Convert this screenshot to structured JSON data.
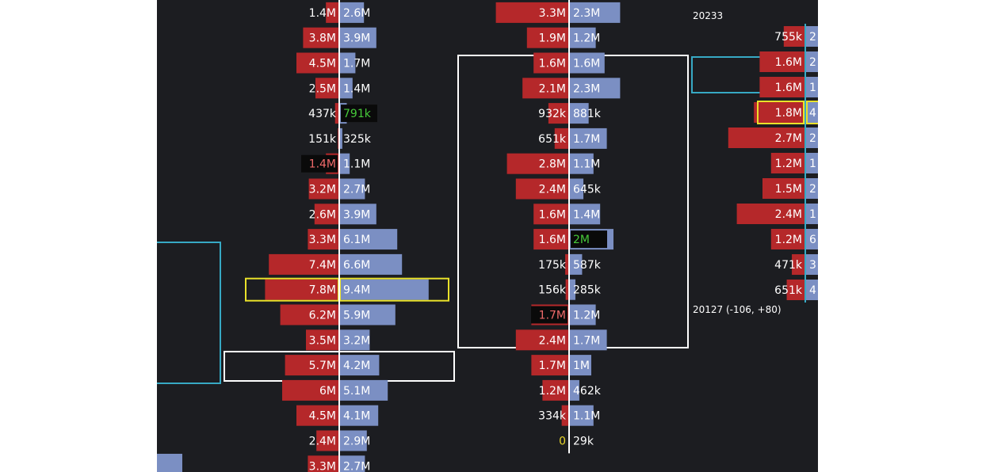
{
  "chart_data": {
    "type": "bar",
    "columns": [
      {
        "name_hint": "",
        "rows": [
          {
            "sell": "1.4M",
            "buy": "2.6M",
            "sell_value": 1.4,
            "buy_value": 2.6
          },
          {
            "sell": "3.8M",
            "buy": "3.9M",
            "sell_value": 3.8,
            "buy_value": 3.9
          },
          {
            "sell": "4.5M",
            "buy": "1.7M",
            "sell_value": 4.5,
            "buy_value": 1.7
          },
          {
            "sell": "2.5M",
            "buy": "1.4M",
            "sell_value": 2.5,
            "buy_value": 1.4
          },
          {
            "sell": "437k",
            "buy": "791k",
            "sell_value": 0.437,
            "buy_value": 0.791,
            "buy_highlight": "green"
          },
          {
            "sell": "151k",
            "buy": "325k",
            "sell_value": 0.151,
            "buy_value": 0.325
          },
          {
            "sell": "1.4M",
            "buy": "1.1M",
            "sell_value": 1.4,
            "buy_value": 1.1,
            "sell_highlight": "red"
          },
          {
            "sell": "3.2M",
            "buy": "2.7M",
            "sell_value": 3.2,
            "buy_value": 2.7
          },
          {
            "sell": "2.6M",
            "buy": "3.9M",
            "sell_value": 2.6,
            "buy_value": 3.9
          },
          {
            "sell": "3.3M",
            "buy": "6.1M",
            "sell_value": 3.3,
            "buy_value": 6.1
          },
          {
            "sell": "7.4M",
            "buy": "6.6M",
            "sell_value": 7.4,
            "buy_value": 6.6
          },
          {
            "sell": "7.8M",
            "buy": "9.4M",
            "sell_value": 7.8,
            "buy_value": 9.4,
            "poc": true
          },
          {
            "sell": "6.2M",
            "buy": "5.9M",
            "sell_value": 6.2,
            "buy_value": 5.9
          },
          {
            "sell": "3.5M",
            "buy": "3.2M",
            "sell_value": 3.5,
            "buy_value": 3.2
          },
          {
            "sell": "5.7M",
            "buy": "4.2M",
            "sell_value": 5.7,
            "buy_value": 4.2
          },
          {
            "sell": "6M",
            "buy": "5.1M",
            "sell_value": 6.0,
            "buy_value": 5.1
          },
          {
            "sell": "4.5M",
            "buy": "4.1M",
            "sell_value": 4.5,
            "buy_value": 4.1
          },
          {
            "sell": "2.4M",
            "buy": "2.9M",
            "sell_value": 2.4,
            "buy_value": 2.9
          },
          {
            "sell": "3.3M",
            "buy": "2.7M",
            "sell_value": 3.3,
            "buy_value": 2.7
          }
        ]
      },
      {
        "rows": [
          {
            "sell": "3.3M",
            "buy": "2.3M",
            "sell_value": 3.3,
            "buy_value": 2.3
          },
          {
            "sell": "1.9M",
            "buy": "1.2M",
            "sell_value": 1.9,
            "buy_value": 1.2
          },
          {
            "sell": "1.6M",
            "buy": "1.6M",
            "sell_value": 1.6,
            "buy_value": 1.6
          },
          {
            "sell": "2.1M",
            "buy": "2.3M",
            "sell_value": 2.1,
            "buy_value": 2.3
          },
          {
            "sell": "932k",
            "buy": "881k",
            "sell_value": 0.932,
            "buy_value": 0.881
          },
          {
            "sell": "651k",
            "buy": "1.7M",
            "sell_value": 0.651,
            "buy_value": 1.7
          },
          {
            "sell": "2.8M",
            "buy": "1.1M",
            "sell_value": 2.8,
            "buy_value": 1.1
          },
          {
            "sell": "2.4M",
            "buy": "645k",
            "sell_value": 2.4,
            "buy_value": 0.645
          },
          {
            "sell": "1.6M",
            "buy": "1.4M",
            "sell_value": 1.6,
            "buy_value": 1.4
          },
          {
            "sell": "1.6M",
            "buy": "2M",
            "sell_value": 1.6,
            "buy_value": 2.0,
            "buy_highlight": "green"
          },
          {
            "sell": "175k",
            "buy": "587k",
            "sell_value": 0.175,
            "buy_value": 0.587
          },
          {
            "sell": "156k",
            "buy": "285k",
            "sell_value": 0.156,
            "buy_value": 0.285
          },
          {
            "sell": "1.7M",
            "buy": "1.2M",
            "sell_value": 1.7,
            "buy_value": 1.2,
            "sell_highlight": "red"
          },
          {
            "sell": "2.4M",
            "buy": "1.7M",
            "sell_value": 2.4,
            "buy_value": 1.7
          },
          {
            "sell": "1.7M",
            "buy": "1M",
            "sell_value": 1.7,
            "buy_value": 1.0
          },
          {
            "sell": "1.2M",
            "buy": "462k",
            "sell_value": 1.2,
            "buy_value": 0.462
          },
          {
            "sell": "334k",
            "buy": "1.1M",
            "sell_value": 0.334,
            "buy_value": 1.1
          },
          {
            "sell": "0",
            "buy": "29k",
            "sell_value": 0,
            "buy_value": 0.029,
            "sell_highlight": "yellow"
          }
        ]
      },
      {
        "rows": [
          {
            "sell": "755k",
            "buy": "2",
            "sell_value": 0.755,
            "buy_value": 2.0
          },
          {
            "sell": "1.6M",
            "buy": "2",
            "sell_value": 1.6,
            "buy_value": 2.0
          },
          {
            "sell": "1.6M",
            "buy": "1",
            "sell_value": 1.6,
            "buy_value": 1.0
          },
          {
            "sell": "1.8M",
            "buy": "4",
            "sell_value": 1.8,
            "buy_value": 4.0,
            "poc": true
          },
          {
            "sell": "2.7M",
            "buy": "2",
            "sell_value": 2.7,
            "buy_value": 2.0
          },
          {
            "sell": "1.2M",
            "buy": "1",
            "sell_value": 1.2,
            "buy_value": 1.0
          },
          {
            "sell": "1.5M",
            "buy": "2",
            "sell_value": 1.5,
            "buy_value": 2.0
          },
          {
            "sell": "2.4M",
            "buy": "1",
            "sell_value": 2.4,
            "buy_value": 1.0
          },
          {
            "sell": "1.2M",
            "buy": "6",
            "sell_value": 1.2,
            "buy_value": 6.0
          },
          {
            "sell": "471k",
            "buy": "3",
            "sell_value": 0.471,
            "buy_value": 3.0
          },
          {
            "sell": "651k",
            "buy": "4",
            "sell_value": 0.651,
            "buy_value": 4.0
          }
        ]
      }
    ],
    "annotations": [
      {
        "text": "20233"
      },
      {
        "text": "20127 (-106, +80)"
      }
    ],
    "colors": {
      "background": "#1c1d21",
      "sell": "#b5282a",
      "buy": "#7b8fc3",
      "poc_outline": "#e9e12a",
      "value_area": "#ffffff",
      "cyan_box": "#37a9c4",
      "green_text": "#46c93a",
      "red_text": "#f06a6a",
      "yellow_text": "#e9d62a"
    }
  }
}
